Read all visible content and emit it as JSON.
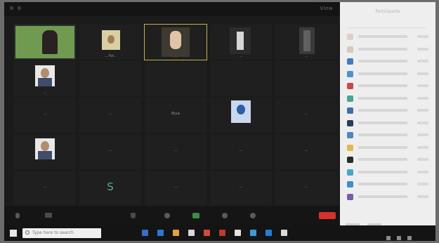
{
  "meeting": {
    "view_label": "View",
    "tiles": [
      {
        "name": "",
        "kind": "video-green"
      },
      {
        "name": "... Fat..",
        "kind": "pic-cream"
      },
      {
        "name": "...",
        "kind": "pic-dark",
        "active": true
      },
      {
        "name": "...",
        "kind": "pic-bw"
      },
      {
        "name": "...",
        "kind": "pic-shadow"
      },
      {
        "name": "...",
        "kind": "pic-portrait"
      },
      {
        "name": "",
        "kind": "empty"
      },
      {
        "name": "",
        "kind": "empty"
      },
      {
        "name": "",
        "kind": "empty"
      },
      {
        "name": "",
        "kind": "empty"
      },
      {
        "name": "...",
        "kind": "name-only"
      },
      {
        "name": "...",
        "kind": "name-only"
      },
      {
        "name": "Riya",
        "kind": "name-only"
      },
      {
        "name": "",
        "kind": "pic-blue"
      },
      {
        "name": "...",
        "kind": "name-only"
      },
      {
        "name": "",
        "kind": "pic-portrait"
      },
      {
        "name": "...",
        "kind": "name-only"
      },
      {
        "name": "...",
        "kind": "name-only"
      },
      {
        "name": "...",
        "kind": "name-only"
      },
      {
        "name": "...",
        "kind": "name-only"
      },
      {
        "name": "...",
        "kind": "name-only"
      },
      {
        "name": "S",
        "kind": "initial"
      },
      {
        "name": "...",
        "kind": "name-only"
      },
      {
        "name": "...",
        "kind": "name-only"
      },
      {
        "name": "...",
        "kind": "name-only"
      }
    ]
  },
  "controls": {
    "end_label": ""
  },
  "panel": {
    "title": "Participants",
    "avatar_colors": [
      "#e0cfc8",
      "#d5c9c2",
      "#3d7ec7",
      "#4a93d6",
      "#d04545",
      "#45a88f",
      "#3d6fb0",
      "#2d3a5c",
      "#4f86c6",
      "#e3b84b",
      "#2a2a2a",
      "#47a6cc",
      "#3b8fd1",
      "#7a5ab5"
    ]
  },
  "taskbar": {
    "search_placeholder": "Type here to search",
    "app_colors": [
      "#3a6fc0",
      "#2b77d8",
      "#e2a43a",
      "#d8d8d8",
      "#d24a3a",
      "#c0392b",
      "#e3e3e3",
      "#3a9bd8",
      "#1e7fd6",
      "#d9d9d9"
    ]
  }
}
